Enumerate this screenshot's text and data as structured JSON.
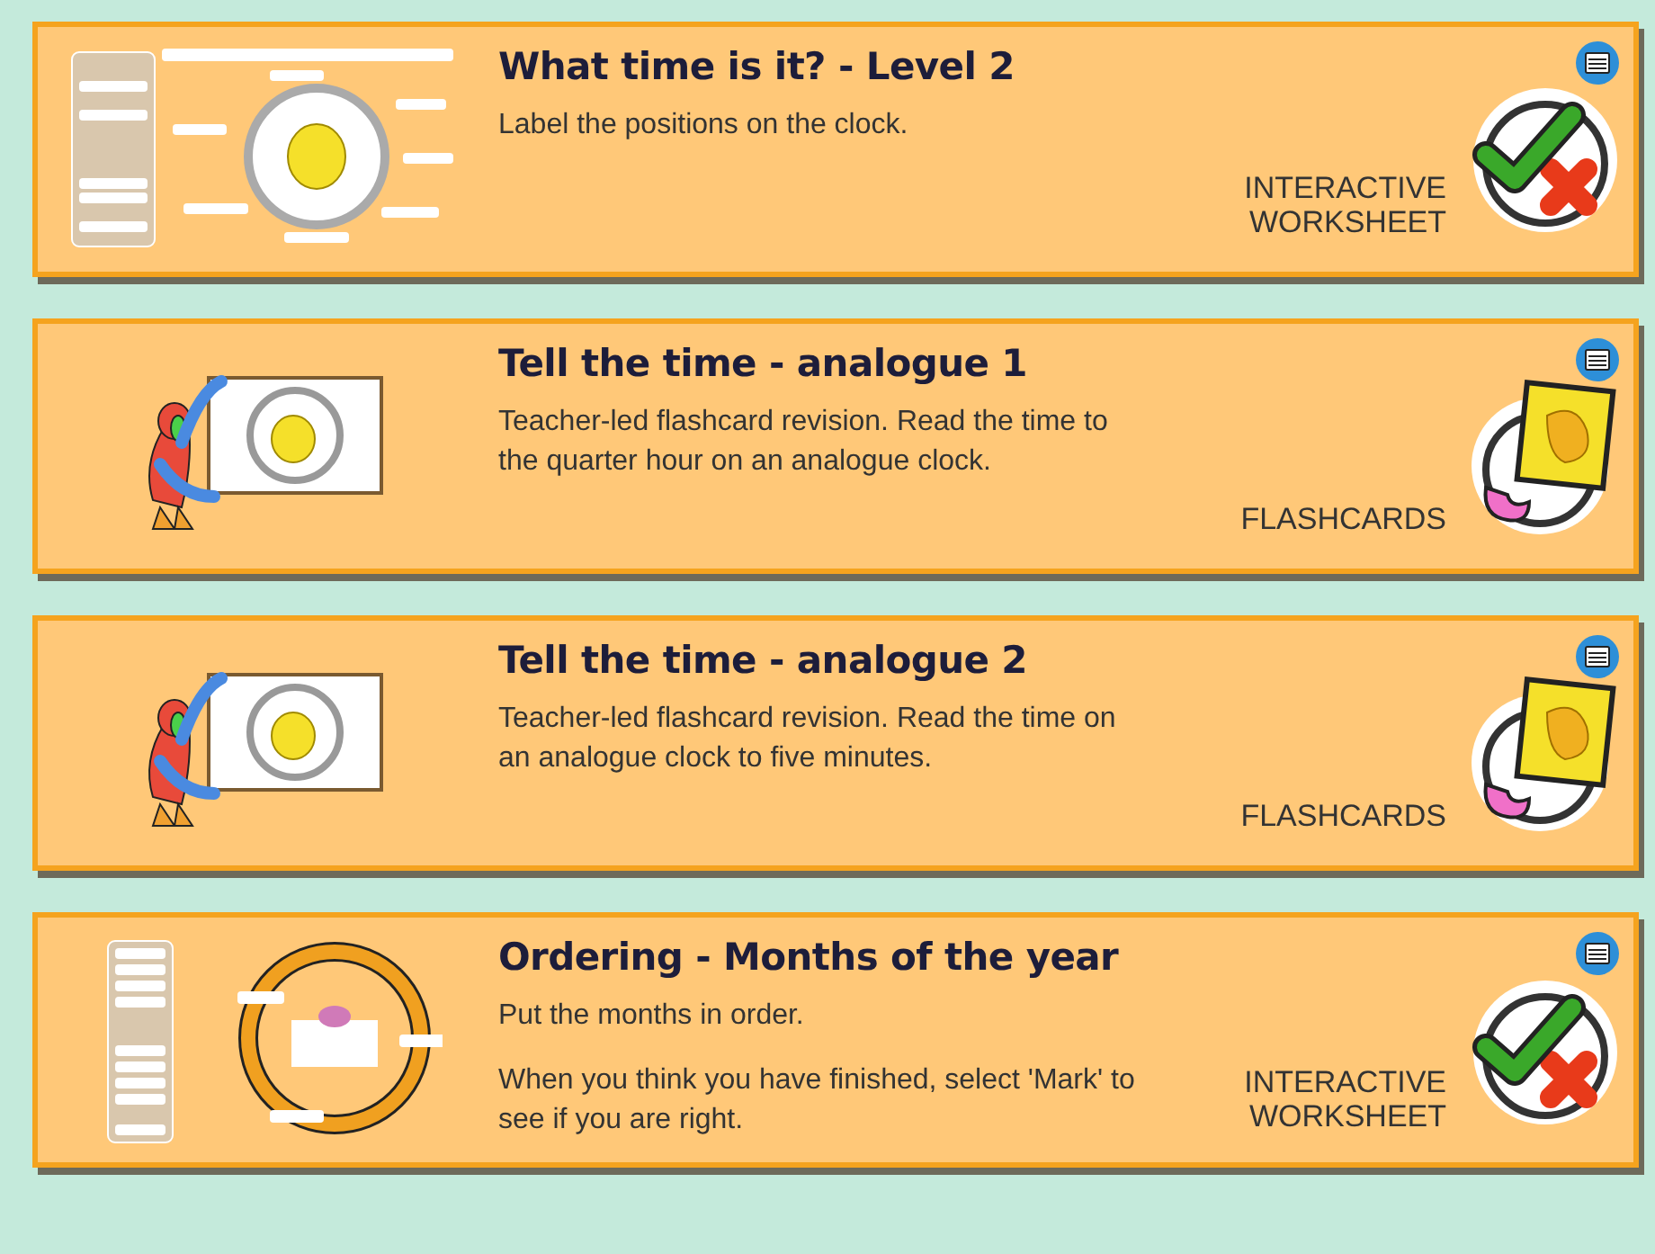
{
  "activities": [
    {
      "title": "What time is it? - Level 2",
      "description": [
        "Label the positions on the clock."
      ],
      "type_label": "INTERACTIVE WORKSHEET",
      "kind": "clock_worksheet"
    },
    {
      "title": "Tell the time - analogue 1",
      "description": [
        "Teacher-led flashcard revision. Read the time to the quarter hour on an analogue clock."
      ],
      "type_label": "FLASHCARDS",
      "kind": "flashcards"
    },
    {
      "title": "Tell the time - analogue 2",
      "description": [
        "Teacher-led flashcard revision. Read the time on an analogue clock to five minutes."
      ],
      "type_label": "FLASHCARDS",
      "kind": "flashcards"
    },
    {
      "title": "Ordering - Months of the year",
      "description": [
        "Put the months in order.",
        "When you think you have finished, select 'Mark' to see if you are right."
      ],
      "type_label": "INTERACTIVE WORKSHEET",
      "kind": "months_worksheet"
    }
  ]
}
